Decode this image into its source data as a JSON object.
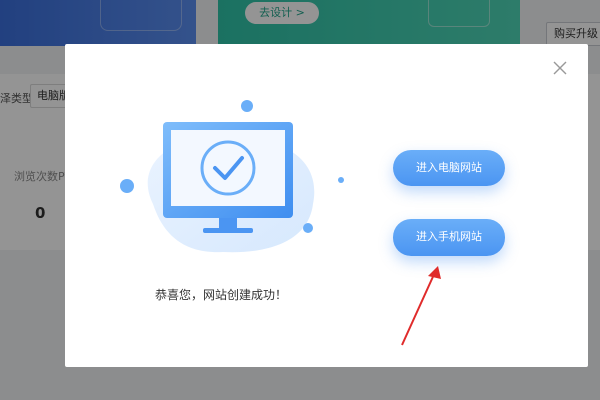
{
  "background": {
    "go_design_label": "去设计 >",
    "buy_upgrade_label": "购买升级",
    "site_type_label": "泽类型:",
    "site_type_value": "电脑版",
    "pv_label": "浏览次数PV",
    "pv_value": "0"
  },
  "modal": {
    "success_message": "恭喜您，网站创建成功！",
    "enter_pc_label": "进入电脑网站",
    "enter_mobile_label": "进入手机网站"
  },
  "colors": {
    "accent_blue": "#5aa1f5",
    "banner_green": "#3ecfb0",
    "annotation_red": "#e02b2b"
  }
}
